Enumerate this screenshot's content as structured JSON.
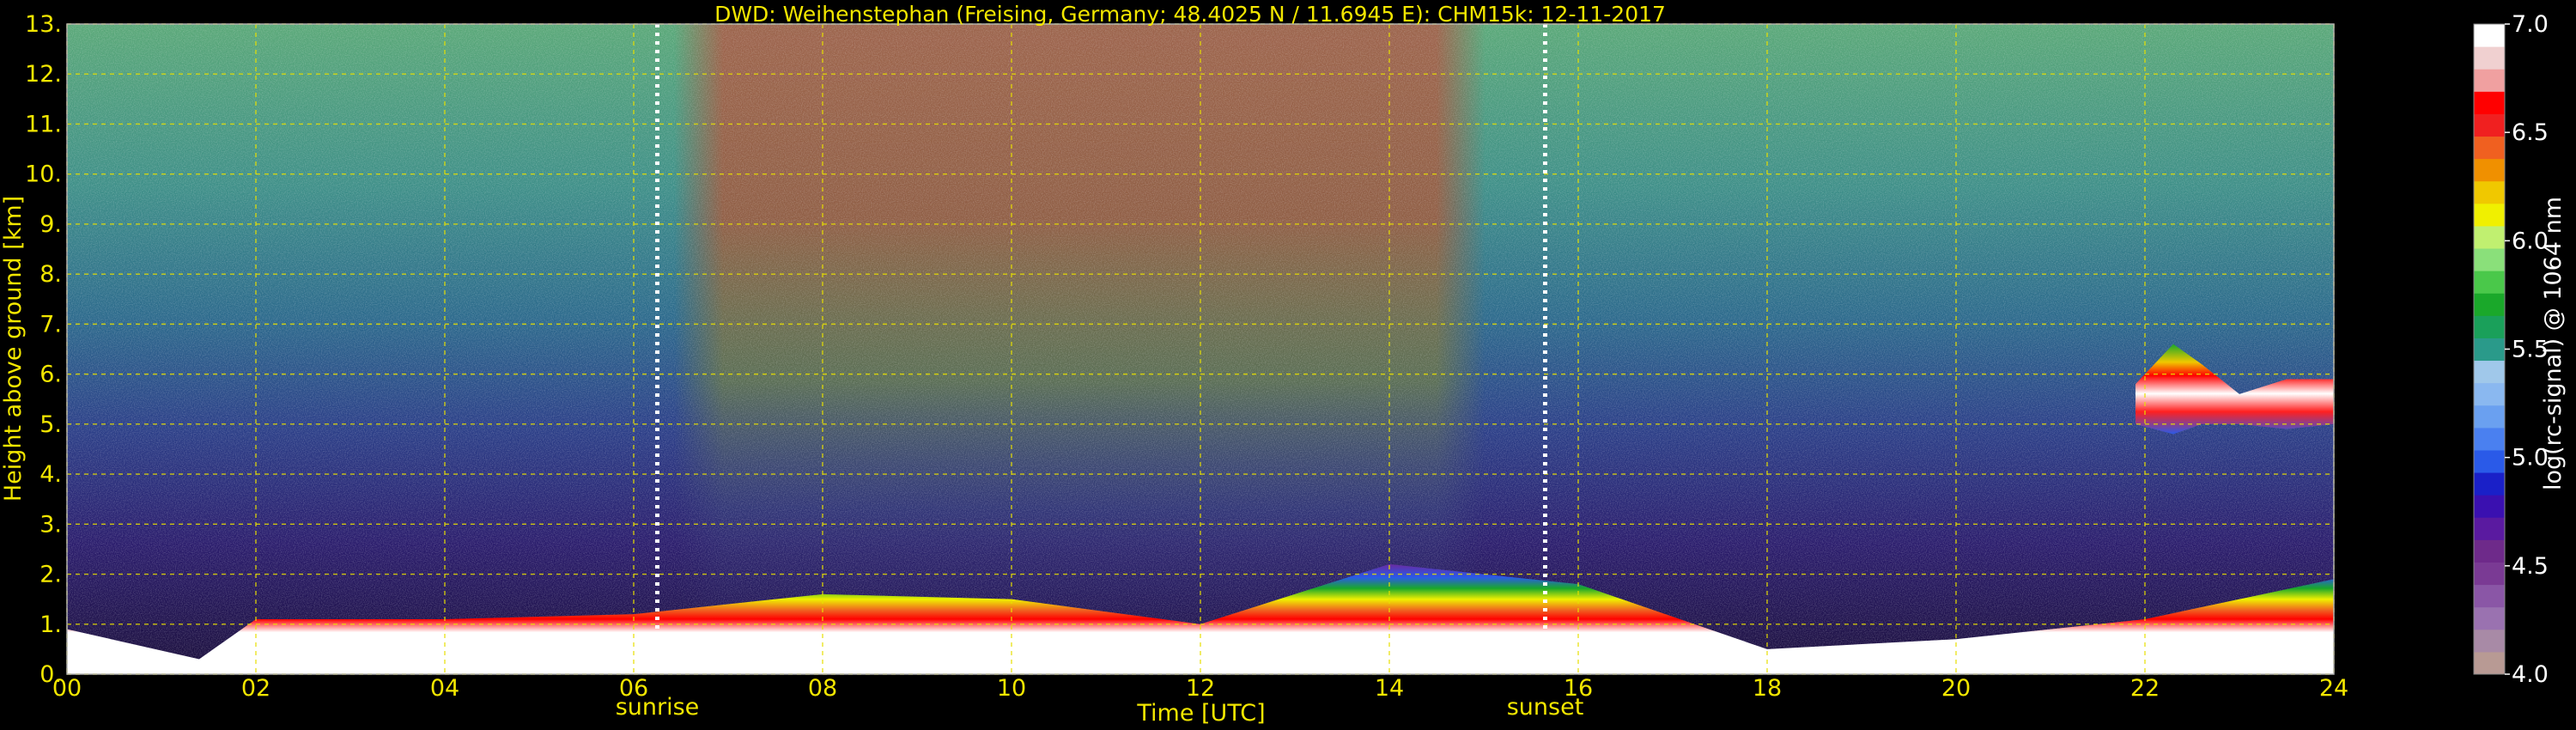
{
  "chart_data": {
    "type": "heatmap",
    "title": "DWD: Weihenstephan (Freising, Germany; 48.4025 N / 11.6945 E):    CHM15k: 12-11-2017",
    "xlabel": "Time [UTC]",
    "ylabel": "Height above ground [km]",
    "xlim": [
      0,
      24
    ],
    "ylim": [
      0,
      13
    ],
    "x_ticks": [
      "00",
      "02",
      "04",
      "06",
      "08",
      "10",
      "12",
      "14",
      "16",
      "18",
      "20",
      "22",
      "24"
    ],
    "x_tick_values": [
      0,
      2,
      4,
      6,
      8,
      10,
      12,
      14,
      16,
      18,
      20,
      22,
      24
    ],
    "y_ticks": [
      "0.",
      "1.",
      "2.",
      "3.",
      "4.",
      "5.",
      "6.",
      "7.",
      "8.",
      "9.",
      "10.",
      "11.",
      "12.",
      "13."
    ],
    "y_tick_values": [
      0,
      1,
      2,
      3,
      4,
      5,
      6,
      7,
      8,
      9,
      10,
      11,
      12,
      13
    ],
    "grid": true,
    "annotations": [
      {
        "label": "sunrise",
        "x": 6.25
      },
      {
        "label": "sunset",
        "x": 15.65
      }
    ],
    "colorbar": {
      "label": "log(rc-signal) @ 1064 nm",
      "range": [
        4.0,
        7.0
      ],
      "ticks": [
        "4.0",
        "4.5",
        "5.0",
        "5.5",
        "6.0",
        "6.5",
        "7.0"
      ],
      "tick_values": [
        4.0,
        4.5,
        5.0,
        5.5,
        6.0,
        6.5,
        7.0
      ],
      "colors": [
        "#b89a94",
        "#a88aa6",
        "#9a72b0",
        "#8a56a6",
        "#7a3a94",
        "#6e2a8a",
        "#5a1aa0",
        "#3a10b0",
        "#1a20c8",
        "#2a5ae8",
        "#4a80f0",
        "#6aa0f0",
        "#8ab8f0",
        "#a0c8ea",
        "#2a9a8a",
        "#1aa05a",
        "#1aa82a",
        "#4ac84a",
        "#8ae07a",
        "#c0f070",
        "#f0f000",
        "#f0c800",
        "#f09000",
        "#f06020",
        "#f02020",
        "#ff0000",
        "#f0a0a0",
        "#f0d0d0",
        "#ffffff"
      ]
    },
    "layers": [
      {
        "name": "boundary-layer aerosol",
        "x": [
          0,
          1.4,
          2,
          4,
          6,
          8,
          10,
          12,
          14,
          16,
          18,
          20,
          22,
          24
        ],
        "top_km": [
          0.9,
          0.3,
          1.1,
          1.1,
          1.2,
          1.6,
          1.5,
          1.0,
          2.2,
          1.8,
          0.5,
          0.7,
          1.1,
          1.9
        ]
      },
      {
        "name": "cloud layer",
        "x": [
          21.9,
          22.3,
          22.6,
          23.0,
          23.5,
          24
        ],
        "base_km": [
          5.0,
          4.8,
          5.0,
          5.0,
          4.9,
          5.0
        ],
        "top_km": [
          5.8,
          6.6,
          6.2,
          5.6,
          5.9,
          5.9
        ]
      }
    ]
  }
}
